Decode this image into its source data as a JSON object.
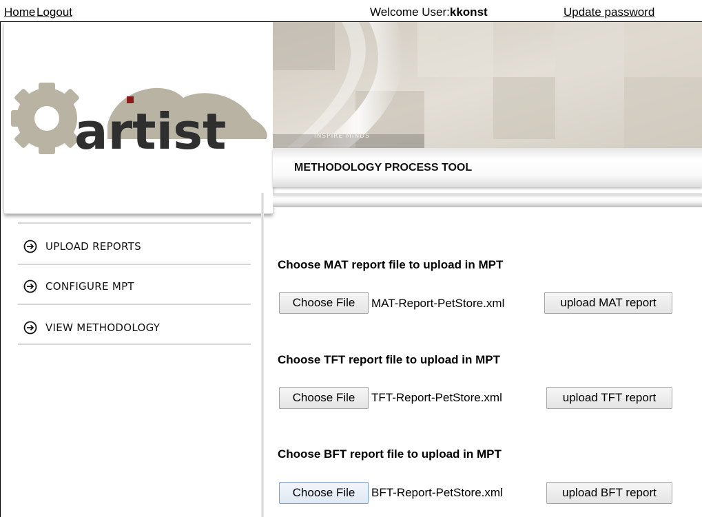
{
  "topbar": {
    "home_label": "Home",
    "logout_label": "Logout",
    "welcome_prefix": "Welcome User:",
    "username": "kkonst",
    "update_password_label": "Update password"
  },
  "logo": {
    "text": "artist"
  },
  "banner": {
    "watermark": "INSPIRE MINDS"
  },
  "tool_title": "METHODOLOGY PROCESS TOOL",
  "menu": [
    {
      "label": "UPLOAD REPORTS",
      "icon": "circle-arrow-right-icon"
    },
    {
      "label": "CONFIGURE MPT",
      "icon": "circle-arrow-right-icon"
    },
    {
      "label": "VIEW METHODOLOGY",
      "icon": "circle-arrow-right-icon"
    }
  ],
  "uploads": [
    {
      "title": "Choose MAT report file to upload in MPT",
      "choose_label": "Choose File",
      "file": "MAT-Report-PetStore.xml",
      "upload_label": "upload MAT report"
    },
    {
      "title": "Choose TFT report file to upload in MPT",
      "choose_label": "Choose File",
      "file": "TFT-Report-PetStore.xml",
      "upload_label": "upload TFT report"
    },
    {
      "title": "Choose BFT report file to upload in MPT",
      "choose_label": "Choose File",
      "file": "BFT-Report-PetStore.xml",
      "upload_label": "upload BFT report"
    }
  ],
  "colors": {
    "logo_dark": "#2f2f2f",
    "logo_gear": "#b8b3a3",
    "logo_accent": "#8b1a1a"
  }
}
